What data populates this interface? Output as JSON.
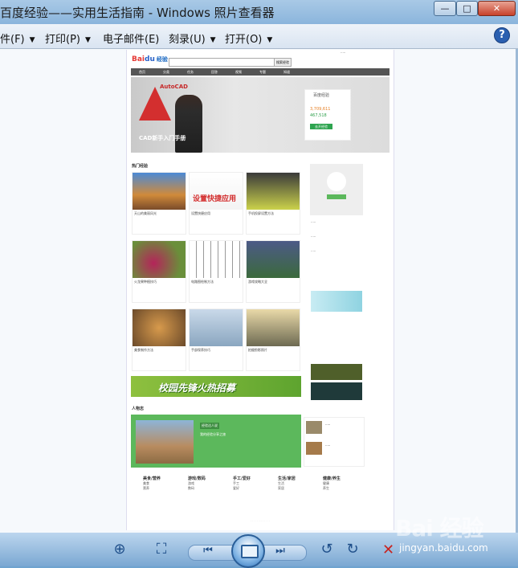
{
  "window": {
    "title": "百度经验——实用生活指南 - Windows 照片查看器",
    "minimize": "—",
    "maximize": "□",
    "close": "✕"
  },
  "menu": [
    {
      "label": "件(F)"
    },
    {
      "label": "打印(P)"
    },
    {
      "label": "电子邮件(E)"
    },
    {
      "label": "刻录(U)"
    },
    {
      "label": "打开(O)"
    }
  ],
  "help": "?",
  "page": {
    "logo_bai": "Bai",
    "logo_du": "du",
    "logo_jy": "经验",
    "search_button": "搜索经验",
    "nav": [
      "首页",
      "分类",
      "任务",
      "回答",
      "视频",
      "专题",
      "知道"
    ],
    "banner": {
      "acad_text": "AutoCAD",
      "title": "CAD新手入门手册",
      "promo_title": "百度经验",
      "promo_n1": "3,709,611",
      "promo_n2": "467,518",
      "promo_btn": "去开经验"
    },
    "section_hot": "热门经验",
    "cards": [
      {
        "tag": "",
        "cap": "天山的美丽风光"
      },
      {
        "tag": "",
        "cap": "设置快捷应用"
      },
      {
        "tag": "",
        "cap": "手机投屏设置方法"
      },
      {
        "tag": "",
        "cap": "火龙果种植技巧"
      },
      {
        "tag": "",
        "cap": "电路图绘制方法"
      },
      {
        "tag": "",
        "cap": "游戏攻略大全"
      },
      {
        "tag": "",
        "cap": "美食制作方法"
      },
      {
        "tag": "",
        "cap": "手部保养技巧"
      },
      {
        "tag": "",
        "cap": "拍摄剪影照片"
      }
    ],
    "ad_banner": "校园先锋火热招募",
    "section_people": "人物志",
    "feature_title": "经验达人说",
    "feature_sub": "我的经验分享之旅",
    "footer_cols": [
      {
        "h": "美食/营养",
        "items": [
          "美食",
          "营养"
        ]
      },
      {
        "h": "游戏/数码",
        "items": [
          "游戏",
          "数码"
        ]
      },
      {
        "h": "手工/爱好",
        "items": [
          "手工",
          "爱好"
        ]
      },
      {
        "h": "生活/家居",
        "items": [
          "生活",
          "家居"
        ]
      },
      {
        "h": "健康/养生",
        "items": [
          "健康",
          "养生"
        ]
      }
    ]
  },
  "watermark": "Bai 经验",
  "watermark_url": "jingyan.baidu.com"
}
